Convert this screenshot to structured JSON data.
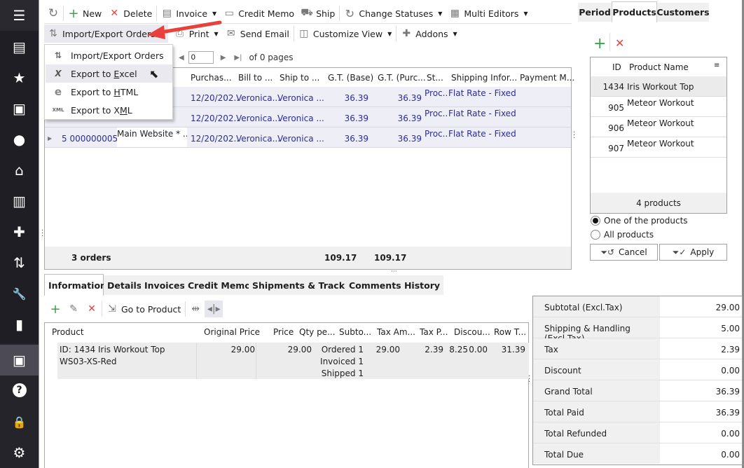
{
  "sidebar": {
    "items": [
      {
        "name": "menu",
        "icon": "☰"
      },
      {
        "name": "store",
        "icon": "▤"
      },
      {
        "name": "favorites",
        "icon": "★"
      },
      {
        "name": "orders",
        "icon": "▣"
      },
      {
        "name": "customers",
        "icon": "●"
      },
      {
        "name": "basket",
        "icon": "⌂"
      },
      {
        "name": "reports",
        "icon": "▥"
      },
      {
        "name": "addons",
        "icon": "✚"
      },
      {
        "name": "import-export",
        "icon": "⇅"
      },
      {
        "name": "tools",
        "icon": "🔧"
      },
      {
        "name": "slides",
        "icon": "▮"
      },
      {
        "name": "archive",
        "icon": "▣"
      },
      {
        "name": "help",
        "icon": "?"
      },
      {
        "name": "lock",
        "icon": "🔒"
      },
      {
        "name": "settings",
        "icon": "⚙"
      }
    ]
  },
  "toolbar": {
    "row1": {
      "new": "New",
      "delete": "Delete",
      "invoice": "Invoice",
      "credit_memo": "Credit Memo",
      "ship": "Ship",
      "change_statuses": "Change Statuses",
      "multi_editors": "Multi Editors"
    },
    "row2": {
      "import_export": "Import/Export Orders",
      "print": "Print",
      "send_email": "Send Email",
      "customize_view": "Customize View",
      "addons": "Addons"
    }
  },
  "menu": {
    "items": [
      {
        "label": "Import/Export Orders",
        "icon": "⇅"
      },
      {
        "label_pre": "Export to ",
        "label_u": "E",
        "label_post": "xcel",
        "icon": "X"
      },
      {
        "label_pre": "Export to ",
        "label_u": "H",
        "label_post": "TML",
        "icon": "e"
      },
      {
        "label_pre": "Export to X",
        "label_u": "M",
        "label_post": "L",
        "icon": "XML"
      }
    ]
  },
  "pager": {
    "page": "0",
    "of_text": "of 0 pages"
  },
  "orders_grid": {
    "columns": [
      "Purchas...",
      "Bill to ...",
      "Ship to ...",
      "G.T. (Base)",
      "G.T. (Purc...",
      "St...",
      "Shipping Infor...",
      "Payment M..."
    ],
    "rows": [
      {
        "id": "",
        "store": "",
        "date": "12/20/202...",
        "bill": "Veronica...",
        "ship": "Veronica ...",
        "gt_base": "36.39",
        "gt_purc": "36.39",
        "status": "Proc...",
        "shipping": "Flat Rate - Fixed"
      },
      {
        "id": "",
        "store": "",
        "date": "12/20/202...",
        "bill": "Veronica...",
        "ship": "Veronica ...",
        "gt_base": "36.39",
        "gt_purc": "36.39",
        "status": "Proc...",
        "shipping": "Flat Rate - Fixed"
      },
      {
        "id": "5 000000005",
        "store": "Main Website * ...",
        "date": "12/20/202...",
        "bill": "Veronica...",
        "ship": "Veronica ...",
        "gt_base": "36.39",
        "gt_purc": "36.39",
        "status": "Proc...",
        "shipping": "Flat Rate - Fixed"
      }
    ],
    "footer": {
      "count": "3 orders",
      "total_base": "109.17",
      "total_purc": "109.17"
    }
  },
  "right_panel": {
    "tabs": [
      "Period",
      "Products",
      "Customers"
    ],
    "grid": {
      "headers": {
        "id": "ID",
        "name": "Product Name"
      },
      "rows": [
        {
          "id": "1434",
          "name": "Iris Workout Top"
        },
        {
          "id": "905",
          "name": "Meteor Workout"
        },
        {
          "id": "906",
          "name": "Meteor Workout"
        },
        {
          "id": "907",
          "name": "Meteor Workout"
        }
      ],
      "footer": "4 products"
    },
    "options": {
      "one": "One of the products",
      "all": "All products",
      "selected": "one"
    },
    "cancel": "Cancel",
    "apply": "Apply"
  },
  "bottom_tabs": [
    "Information",
    "Details",
    "Invoices",
    "Credit Memos",
    "Shipments & Tracking",
    "Comments History"
  ],
  "info_toolbar": {
    "go_to_product": "Go to Product"
  },
  "items_grid": {
    "columns": [
      "Product",
      "Original Price",
      "Price",
      "Qty pe...",
      "Subto...",
      "Tax Am...",
      "Tax P...",
      "Discou...",
      "Row T..."
    ],
    "row": {
      "product_line1": "ID: 1434 Iris Workout Top",
      "product_line2": "WS03-XS-Red",
      "original_price": "29.00",
      "price": "29.00",
      "qty_ordered": "Ordered 1",
      "qty_invoiced": "Invoiced 1",
      "qty_shipped": "Shipped 1",
      "subtotal": "29.00",
      "tax_amount": "2.39",
      "tax_percent": "8.25",
      "discount": "0.00",
      "row_total": "31.39"
    }
  },
  "totals": [
    {
      "label": "Subtotal (Excl.Tax)",
      "value": "29.00"
    },
    {
      "label": "Shipping & Handling (Excl.Tax)",
      "value": "5.00"
    },
    {
      "label": "Tax",
      "value": "2.39"
    },
    {
      "label": "Discount",
      "value": "0.00"
    },
    {
      "label": "Grand Total",
      "value": "36.39"
    },
    {
      "label": "Total Paid",
      "value": "36.39"
    },
    {
      "label": "Total Refunded",
      "value": "0.00"
    },
    {
      "label": "Total Due",
      "value": "0.00"
    }
  ],
  "colors": {
    "accent_link": "#2b2b9c",
    "arrow": "#e8413b",
    "sidebar": "#1f1e24",
    "active_sidebar": "#4b4a55"
  }
}
